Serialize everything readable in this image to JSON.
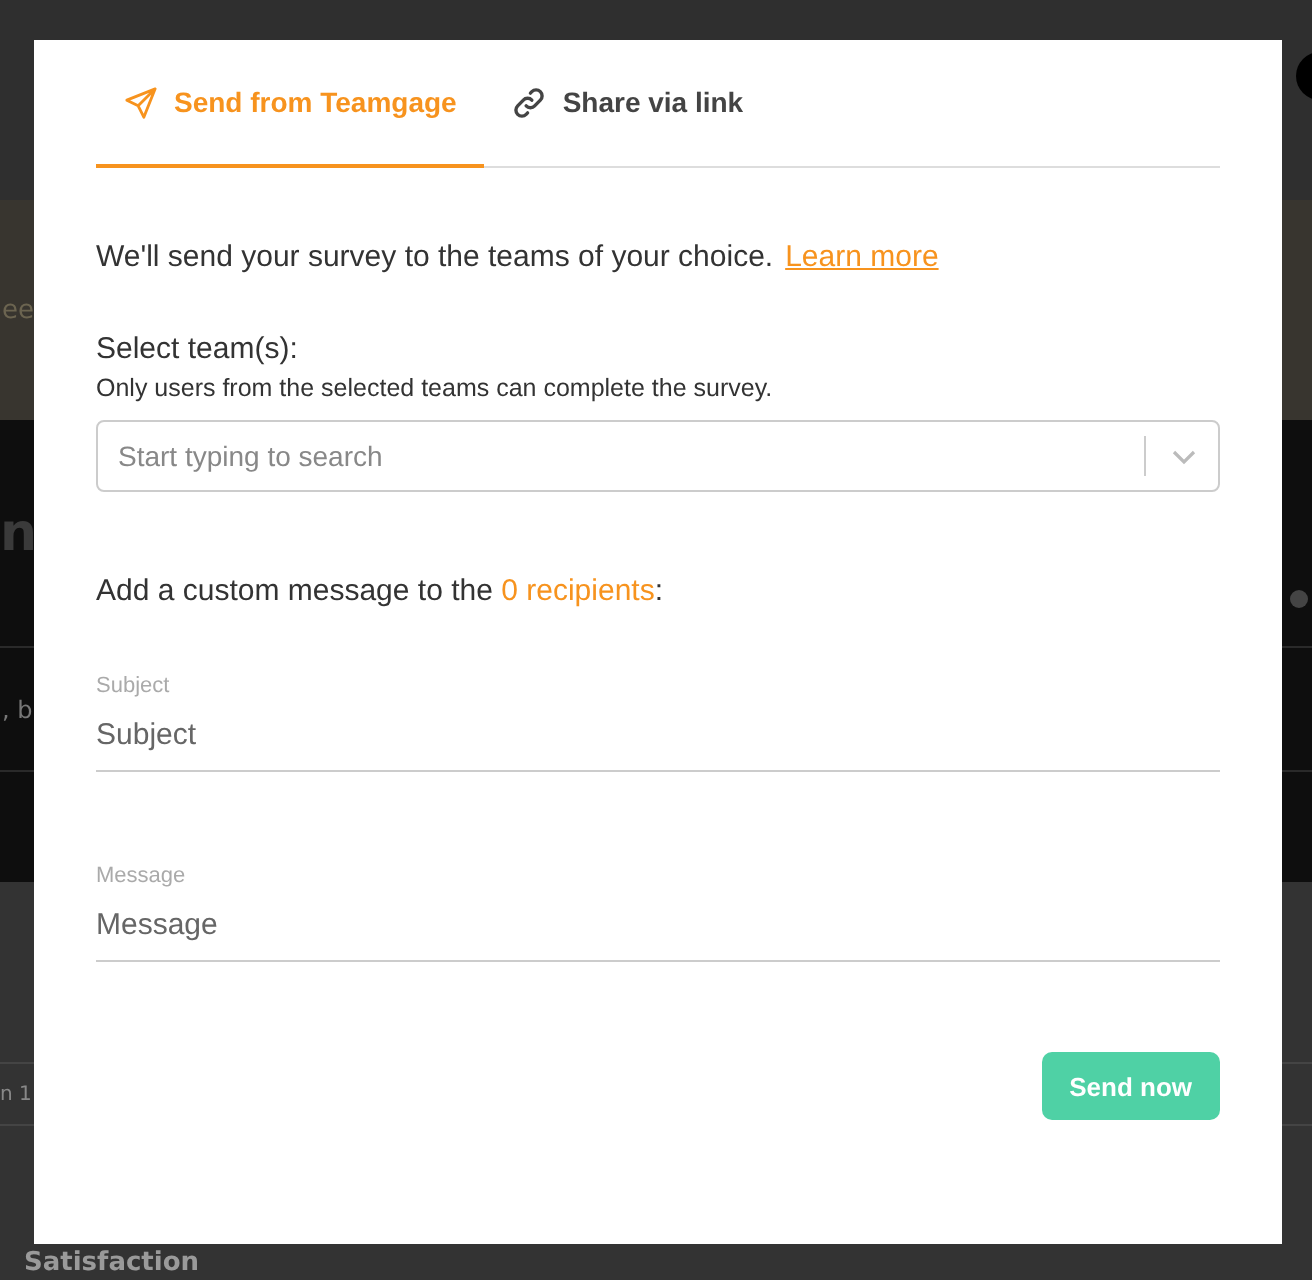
{
  "background": {
    "banner_text": "ee",
    "hero_text": "n",
    "subtitle_text": ", b",
    "row_text": "n 1",
    "section_title": "Satisfaction"
  },
  "modal": {
    "tabs": [
      {
        "label": "Send from Teamgage",
        "kind": "send",
        "selected": true
      },
      {
        "label": "Share via link",
        "kind": "link",
        "selected": false
      }
    ],
    "intro": "We'll send your survey to the teams of your choice.",
    "learn_more": "Learn more",
    "team_label": "Select team(s):",
    "team_hint": "Only users from the selected teams can complete the survey.",
    "team_search": {
      "placeholder": "Start typing to search"
    },
    "message_intro": "Add a custom message to the ",
    "recipients": "0 recipients",
    "message_intro_end": ":",
    "fields": [
      {
        "label": "Subject",
        "placeholder": "Subject"
      },
      {
        "label": "Message",
        "placeholder": "Message"
      }
    ],
    "send_button": "Send now"
  }
}
